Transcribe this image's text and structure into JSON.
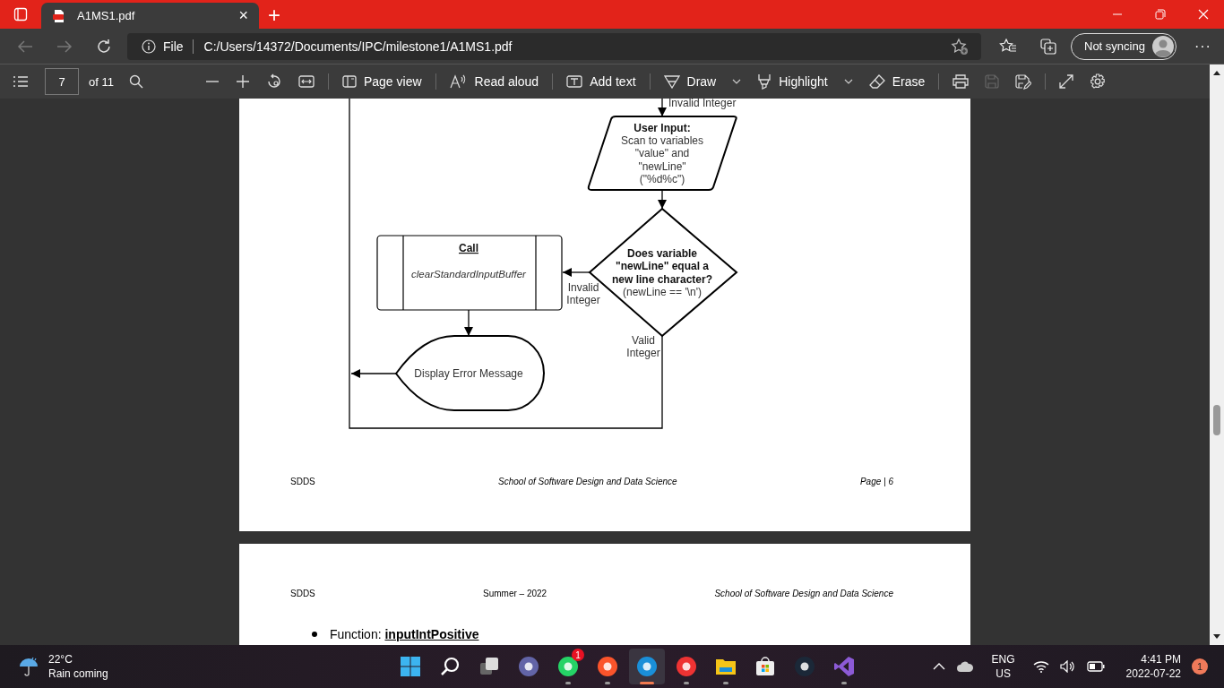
{
  "browser_tab": {
    "title": "A1MS1.pdf",
    "close": "×",
    "selected": true
  },
  "new_tab": "+",
  "address_bar": {
    "scheme": "File",
    "url": "C:/Users/14372/Documents/IPC/milestone1/A1MS1.pdf"
  },
  "profile": {
    "label": "Not syncing"
  },
  "more_menu": "···",
  "pdf_toolbar": {
    "page_number": "7",
    "page_count": "of 11",
    "tools": [
      {
        "label": "Page view",
        "has_menu": false
      },
      {
        "label": "Read aloud",
        "has_menu": false
      },
      {
        "label": "Add text",
        "has_menu": false
      },
      {
        "label": "Draw",
        "has_menu": true
      },
      {
        "label": "Highlight",
        "has_menu": true
      },
      {
        "label": "Erase",
        "has_menu": false
      }
    ],
    "file_actions": [
      {
        "disabled": false
      },
      {
        "disabled": true
      },
      {
        "disabled": false
      }
    ]
  },
  "pages": [
    {
      "flowchart": {
        "top_label": "Invalid Integer",
        "input": {
          "title": "User Input:",
          "lines": [
            "Scan to variables",
            "\"value\" and",
            "\"newLine\"",
            "(\"%d%c\")"
          ]
        },
        "decision": {
          "question": [
            "Does variable",
            "\"newLine\" equal a",
            "new line character?"
          ],
          "condition": "(newLine == '\\n')"
        },
        "invalid_label": [
          "Invalid",
          "Integer"
        ],
        "valid_label": [
          "Valid",
          "Integer"
        ],
        "process": {
          "title": "Call",
          "function": "clearStandardInputBuffer"
        },
        "display": "Display Error Message"
      },
      "footer": {
        "left": "SDDS",
        "center": "School of Software Design and Data Science",
        "right": "Page | 6"
      }
    },
    {
      "header": {
        "left": "SDDS",
        "center": "Summer – 2022",
        "right": "School of Software Design and Data Science"
      },
      "bullet": {
        "label": "Function:",
        "name": "inputIntPositive"
      }
    }
  ],
  "taskbar": {
    "weather": {
      "temperature": "22°C",
      "forecast": "Rain coming"
    },
    "apps": [
      {
        "running": false,
        "active": false
      },
      {
        "running": false,
        "active": false
      },
      {
        "running": false,
        "active": false
      },
      {
        "running": false,
        "active": false
      },
      {
        "running": true,
        "active": false,
        "badge": "1"
      },
      {
        "running": true,
        "active": false
      },
      {
        "running": true,
        "active": true
      },
      {
        "running": true,
        "active": false
      },
      {
        "running": true,
        "active": false
      },
      {
        "running": false,
        "active": false
      },
      {
        "running": false,
        "active": false
      },
      {
        "running": true,
        "active": false
      }
    ],
    "language": [
      "ENG",
      "US"
    ],
    "time": "4:41 PM",
    "date": "2022-07-22",
    "notifications": "1"
  }
}
